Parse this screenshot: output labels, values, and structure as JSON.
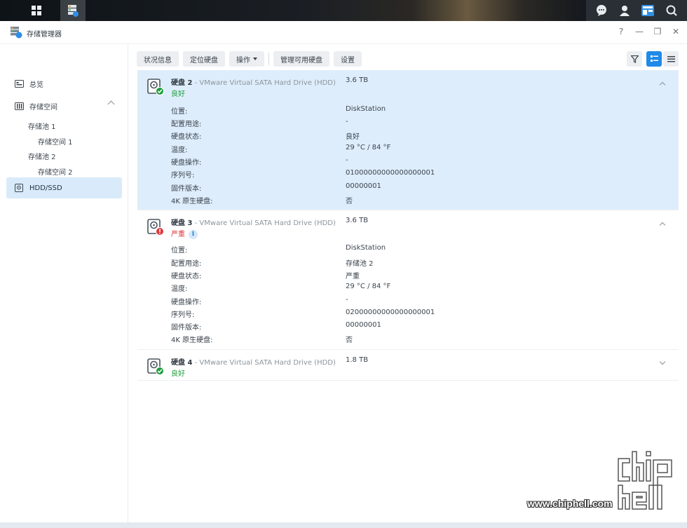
{
  "taskbar": {
    "apps_icon": "grid-icon",
    "storage_icon": "storage-manager-icon",
    "right_icons": [
      "chat-icon",
      "user-icon",
      "widget-icon",
      "search-icon"
    ]
  },
  "window": {
    "title": "存储管理器",
    "controls": [
      "?",
      "—",
      "❐",
      "✕"
    ]
  },
  "sidebar": {
    "overview": "总览",
    "storage": "存储空间",
    "pool1": "存储池 1",
    "vol1": "存储空间 1",
    "pool2": "存储池 2",
    "vol2": "存储空间 2",
    "hdd": "HDD/SSD"
  },
  "toolbar": {
    "status": "状况信息",
    "locate": "定位硬盘",
    "action": "操作",
    "manage": "管理可用硬盘",
    "settings": "设置"
  },
  "labels": {
    "location": "位置:",
    "usage": "配置用途:",
    "disk_status": "硬盘状态:",
    "temperature": "温度:",
    "disk_ops": "硬盘操作:",
    "serial": "序列号:",
    "firmware": "固件版本:",
    "native4k": "4K 原生硬盘:"
  },
  "disks": [
    {
      "name": "硬盘 2",
      "model": " - VMware Virtual SATA Hard Drive (HDD)",
      "size": "3.6 TB",
      "status": "良好",
      "details": {
        "location": "DiskStation",
        "usage": "-",
        "disk_status": "良好",
        "temperature": "29 °C / 84 °F",
        "disk_ops": "-",
        "serial": "01000000000000000001",
        "firmware": "00000001",
        "native4k": "否"
      }
    },
    {
      "name": "硬盘 3",
      "model": " - VMware Virtual SATA Hard Drive (HDD)",
      "size": "3.6 TB",
      "status": "严重",
      "details": {
        "location": "DiskStation",
        "usage": "存储池 2",
        "disk_status": "严重",
        "temperature": "29 °C / 84 °F",
        "disk_ops": "-",
        "serial": "02000000000000000001",
        "firmware": "00000001",
        "native4k": "否"
      }
    },
    {
      "name": "硬盘 4",
      "model": " - VMware Virtual SATA Hard Drive (HDD)",
      "size": "1.8 TB",
      "status": "良好"
    }
  ],
  "colors": {
    "ok": "#1d9e3d",
    "critical": "#e0373b",
    "accent": "#1f8ae8",
    "selected_bg": "#deedfb"
  },
  "watermark": {
    "url": "www.chiphell.com"
  }
}
